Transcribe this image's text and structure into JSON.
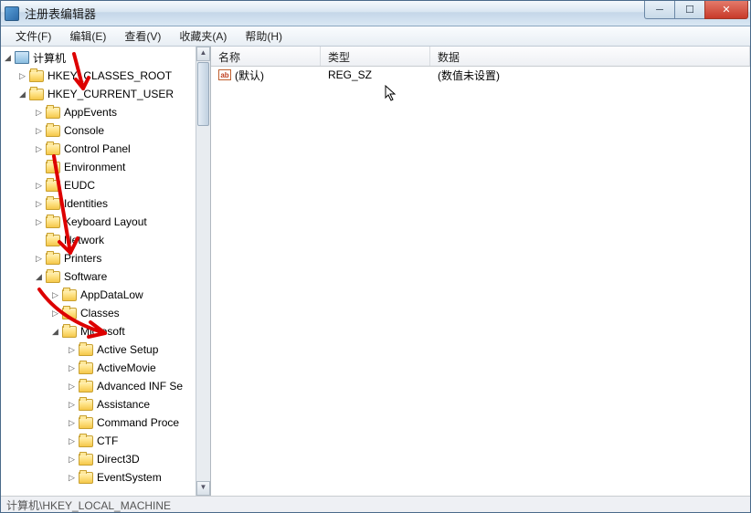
{
  "window": {
    "title": "注册表编辑器"
  },
  "menu": {
    "file": "文件(F)",
    "edit": "编辑(E)",
    "view": "查看(V)",
    "favorites": "收藏夹(A)",
    "help": "帮助(H)"
  },
  "tree": {
    "root": "计算机",
    "hkcr": "HKEY_CLASSES_ROOT",
    "hkcu": "HKEY_CURRENT_USER",
    "hkcu_children": {
      "appevents": "AppEvents",
      "console": "Console",
      "controlpanel": "Control Panel",
      "environment": "Environment",
      "eudc": "EUDC",
      "identities": "Identities",
      "keyboard": "Keyboard Layout",
      "network": "Network",
      "printers": "Printers",
      "software": "Software"
    },
    "software_children": {
      "appdatalow": "AppDataLow",
      "classes": "Classes",
      "microsoft": "Microsoft"
    },
    "microsoft_children": {
      "activesetup": "Active Setup",
      "activemovie": "ActiveMovie",
      "advinf": "Advanced INF Se",
      "assistance": "Assistance",
      "cmdproc": "Command Proce",
      "ctf": "CTF",
      "direct3d": "Direct3D",
      "eventsystem": "EventSystem"
    }
  },
  "list": {
    "headers": {
      "name": "名称",
      "type": "类型",
      "data": "数据"
    },
    "rows": [
      {
        "icon": "ab",
        "name": "(默认)",
        "type": "REG_SZ",
        "data": "(数值未设置)"
      }
    ]
  },
  "status": "计算机\\HKEY_LOCAL_MACHINE"
}
